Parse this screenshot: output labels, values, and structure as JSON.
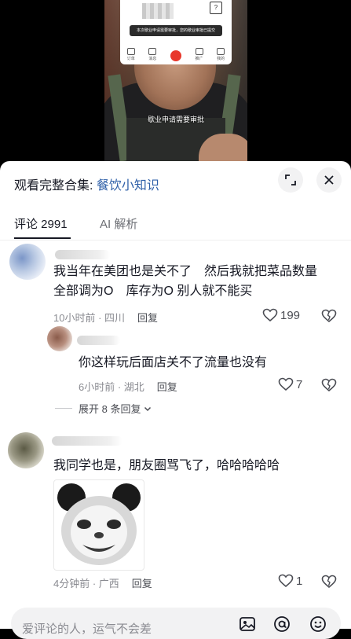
{
  "video": {
    "toast_text": "本次歇业申请需要审批，您的歇业审批已提交",
    "caption": "歇业申请需要审批",
    "phone_tabs": [
      "订单",
      "消息",
      "",
      "推广",
      "我的"
    ]
  },
  "sheet": {
    "collection_prefix": "观看完整合集: ",
    "collection_name": "餐饮小知识",
    "tabs": {
      "comments": "评论 2991",
      "ai": "AI 解析"
    }
  },
  "comments": [
    {
      "text_line1": "我当年在美团也是关不了　然后我就把菜品数量",
      "text_line2": "全部调为O　库存为O 别人就不能买",
      "meta": "10小时前 · 四川",
      "reply": "回复",
      "likes": "199"
    },
    {
      "text": "你这样玩后面店关不了流量也没有",
      "meta": "6小时前 · 湖北",
      "reply": "回复",
      "likes": "7"
    },
    {
      "text": "我同学也是，朋友圈骂飞了，哈哈哈哈哈",
      "meta": "4分钟前 · 广西",
      "reply": "回复",
      "likes": "1"
    }
  ],
  "expand_replies": "展开 8 条回复",
  "input": {
    "placeholder": "爱评论的人，运气不会差"
  },
  "colors": {
    "link": "#2e5fa8",
    "text": "#161823",
    "muted": "#8a8b91"
  }
}
